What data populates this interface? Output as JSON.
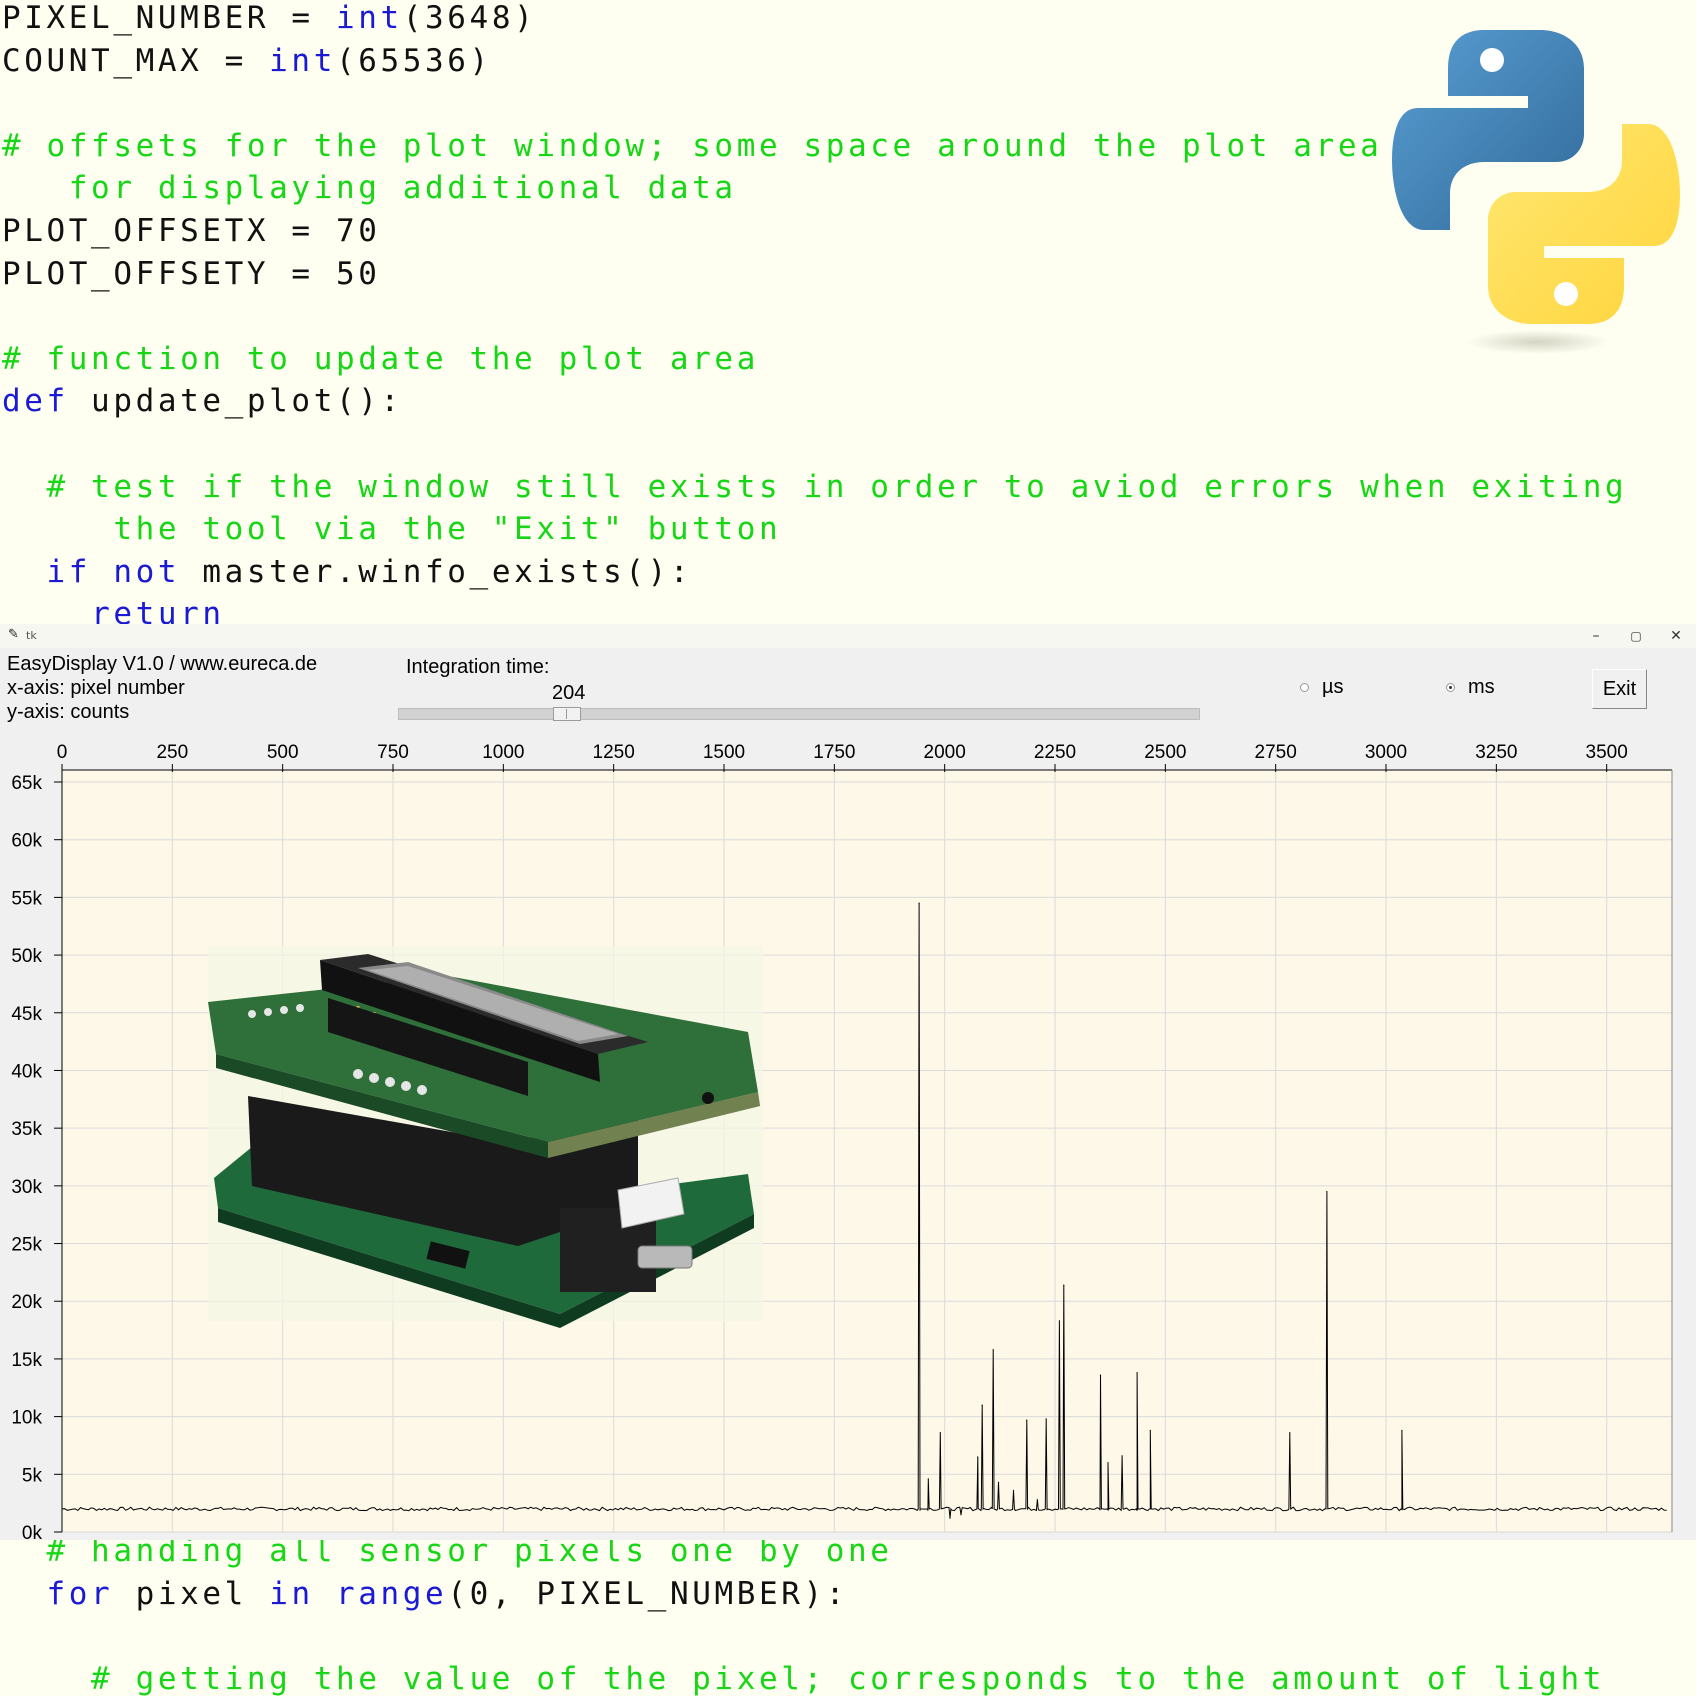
{
  "code_top": [
    [
      [
        "PIXEL_NUMBER = ",
        ""
      ],
      [
        "int",
        "kw"
      ],
      [
        "(3648)",
        ""
      ]
    ],
    [
      [
        "COUNT_MAX = ",
        ""
      ],
      [
        "int",
        "kw"
      ],
      [
        "(65536)",
        ""
      ]
    ],
    [],
    [
      [
        "# offsets for the plot window; some space around the plot area is used",
        "cm"
      ]
    ],
    [
      [
        "   for displaying additional data",
        "cm"
      ]
    ],
    [
      [
        "PLOT_OFFSETX = 70",
        ""
      ]
    ],
    [
      [
        "PLOT_OFFSETY = 50",
        ""
      ]
    ],
    [],
    [
      [
        "# function to update the plot area",
        "cm"
      ]
    ],
    [
      [
        "def",
        "kw"
      ],
      [
        " update_plot():",
        ""
      ]
    ],
    [],
    [
      [
        "  # test if the window still exists in order to aviod errors when exiting",
        "cm"
      ]
    ],
    [
      [
        "     the tool via the \"Exit\" button",
        "cm"
      ]
    ],
    [
      [
        "  ",
        ""
      ],
      [
        "if",
        "kw"
      ],
      [
        " ",
        ""
      ],
      [
        "not",
        "kw"
      ],
      [
        " master.winfo_exists():",
        ""
      ]
    ],
    [
      [
        "    ",
        ""
      ],
      [
        "return",
        "kw"
      ]
    ]
  ],
  "code_bottom": [
    [
      [
        "  # handing all sensor pixels one by one",
        "cm"
      ]
    ],
    [
      [
        "  ",
        ""
      ],
      [
        "for",
        "kw"
      ],
      [
        " pixel ",
        ""
      ],
      [
        "in",
        "kw"
      ],
      [
        " ",
        ""
      ],
      [
        "range",
        "kw"
      ],
      [
        "(0, PIXEL_NUMBER):",
        ""
      ]
    ],
    [],
    [
      [
        "    # getting the value of the pixel; corresponds to the amount of light",
        "cm"
      ]
    ]
  ],
  "window": {
    "title": "tk",
    "minimize": "–",
    "maximize": "▢",
    "close": "✕"
  },
  "info": {
    "line1": "EasyDisplay V1.0 / www.eureca.de",
    "line2": "x-axis: pixel number",
    "line3": "y-axis: counts"
  },
  "integration": {
    "label": "Integration time:",
    "value": "204",
    "slider_fraction": 0.2
  },
  "units": {
    "us_label": "µs",
    "ms_label": "ms",
    "selected": "ms"
  },
  "exit_label": "Exit",
  "colors": {
    "code_bg": "#fefff0",
    "keyword": "#1a1ad6",
    "comment": "#16d616",
    "plot_bg": "#fdf8e8",
    "grid": "#dadada",
    "trace": "#000000"
  },
  "icons": {
    "python_logo": "python-logo-icon",
    "sensor_board": "ccd-sensor-board-photo"
  },
  "chart_data": {
    "type": "line",
    "title": "",
    "xlabel": "pixel number",
    "ylabel": "counts",
    "xlim": [
      0,
      3648
    ],
    "ylim": [
      0,
      65536
    ],
    "xticks": [
      0,
      250,
      500,
      750,
      1000,
      1250,
      1500,
      1750,
      2000,
      2250,
      2500,
      2750,
      3000,
      3250,
      3500
    ],
    "yticks": [
      0,
      5,
      10,
      15,
      20,
      25,
      30,
      35,
      40,
      45,
      50,
      55,
      60,
      65
    ],
    "ytick_suffix": "k",
    "grid": true,
    "baseline": 2000,
    "peaks": [
      {
        "x": 1942,
        "y": 54500
      },
      {
        "x": 1963,
        "y": 4600
      },
      {
        "x": 1990,
        "y": 8600
      },
      {
        "x": 2012,
        "y": 1200
      },
      {
        "x": 2037,
        "y": 1500
      },
      {
        "x": 2075,
        "y": 6500
      },
      {
        "x": 2085,
        "y": 11000
      },
      {
        "x": 2110,
        "y": 15800
      },
      {
        "x": 2122,
        "y": 4300
      },
      {
        "x": 2156,
        "y": 3600
      },
      {
        "x": 2186,
        "y": 9700
      },
      {
        "x": 2210,
        "y": 2800
      },
      {
        "x": 2230,
        "y": 9800
      },
      {
        "x": 2260,
        "y": 18300
      },
      {
        "x": 2270,
        "y": 21400
      },
      {
        "x": 2353,
        "y": 13600
      },
      {
        "x": 2370,
        "y": 6000
      },
      {
        "x": 2402,
        "y": 6600
      },
      {
        "x": 2436,
        "y": 13800
      },
      {
        "x": 2466,
        "y": 8800
      },
      {
        "x": 2782,
        "y": 8600
      },
      {
        "x": 2866,
        "y": 29500
      },
      {
        "x": 3036,
        "y": 8800
      }
    ]
  }
}
